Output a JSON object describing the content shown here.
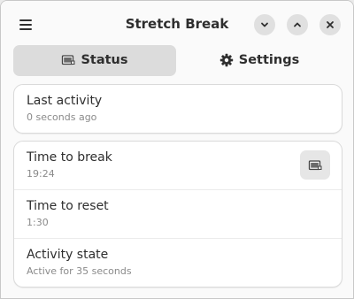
{
  "window": {
    "title": "Stretch Break"
  },
  "tabs": [
    {
      "label": "Status",
      "active": true,
      "icon": "status-icon"
    },
    {
      "label": "Settings",
      "active": false,
      "icon": "gear-icon"
    }
  ],
  "last_activity": {
    "label": "Last activity",
    "value": "0 seconds ago"
  },
  "timers": {
    "break": {
      "label": "Time to break",
      "value": "19:24",
      "action_icon": "take-break-icon"
    },
    "reset": {
      "label": "Time to reset",
      "value": "1:30"
    },
    "state": {
      "label": "Activity state",
      "value": "Active for 35 seconds"
    }
  },
  "colors": {
    "accent_text": "#2e2e2e",
    "active_tab_bg": "#dcdcdc",
    "subtitle": "#8a8a8a"
  }
}
